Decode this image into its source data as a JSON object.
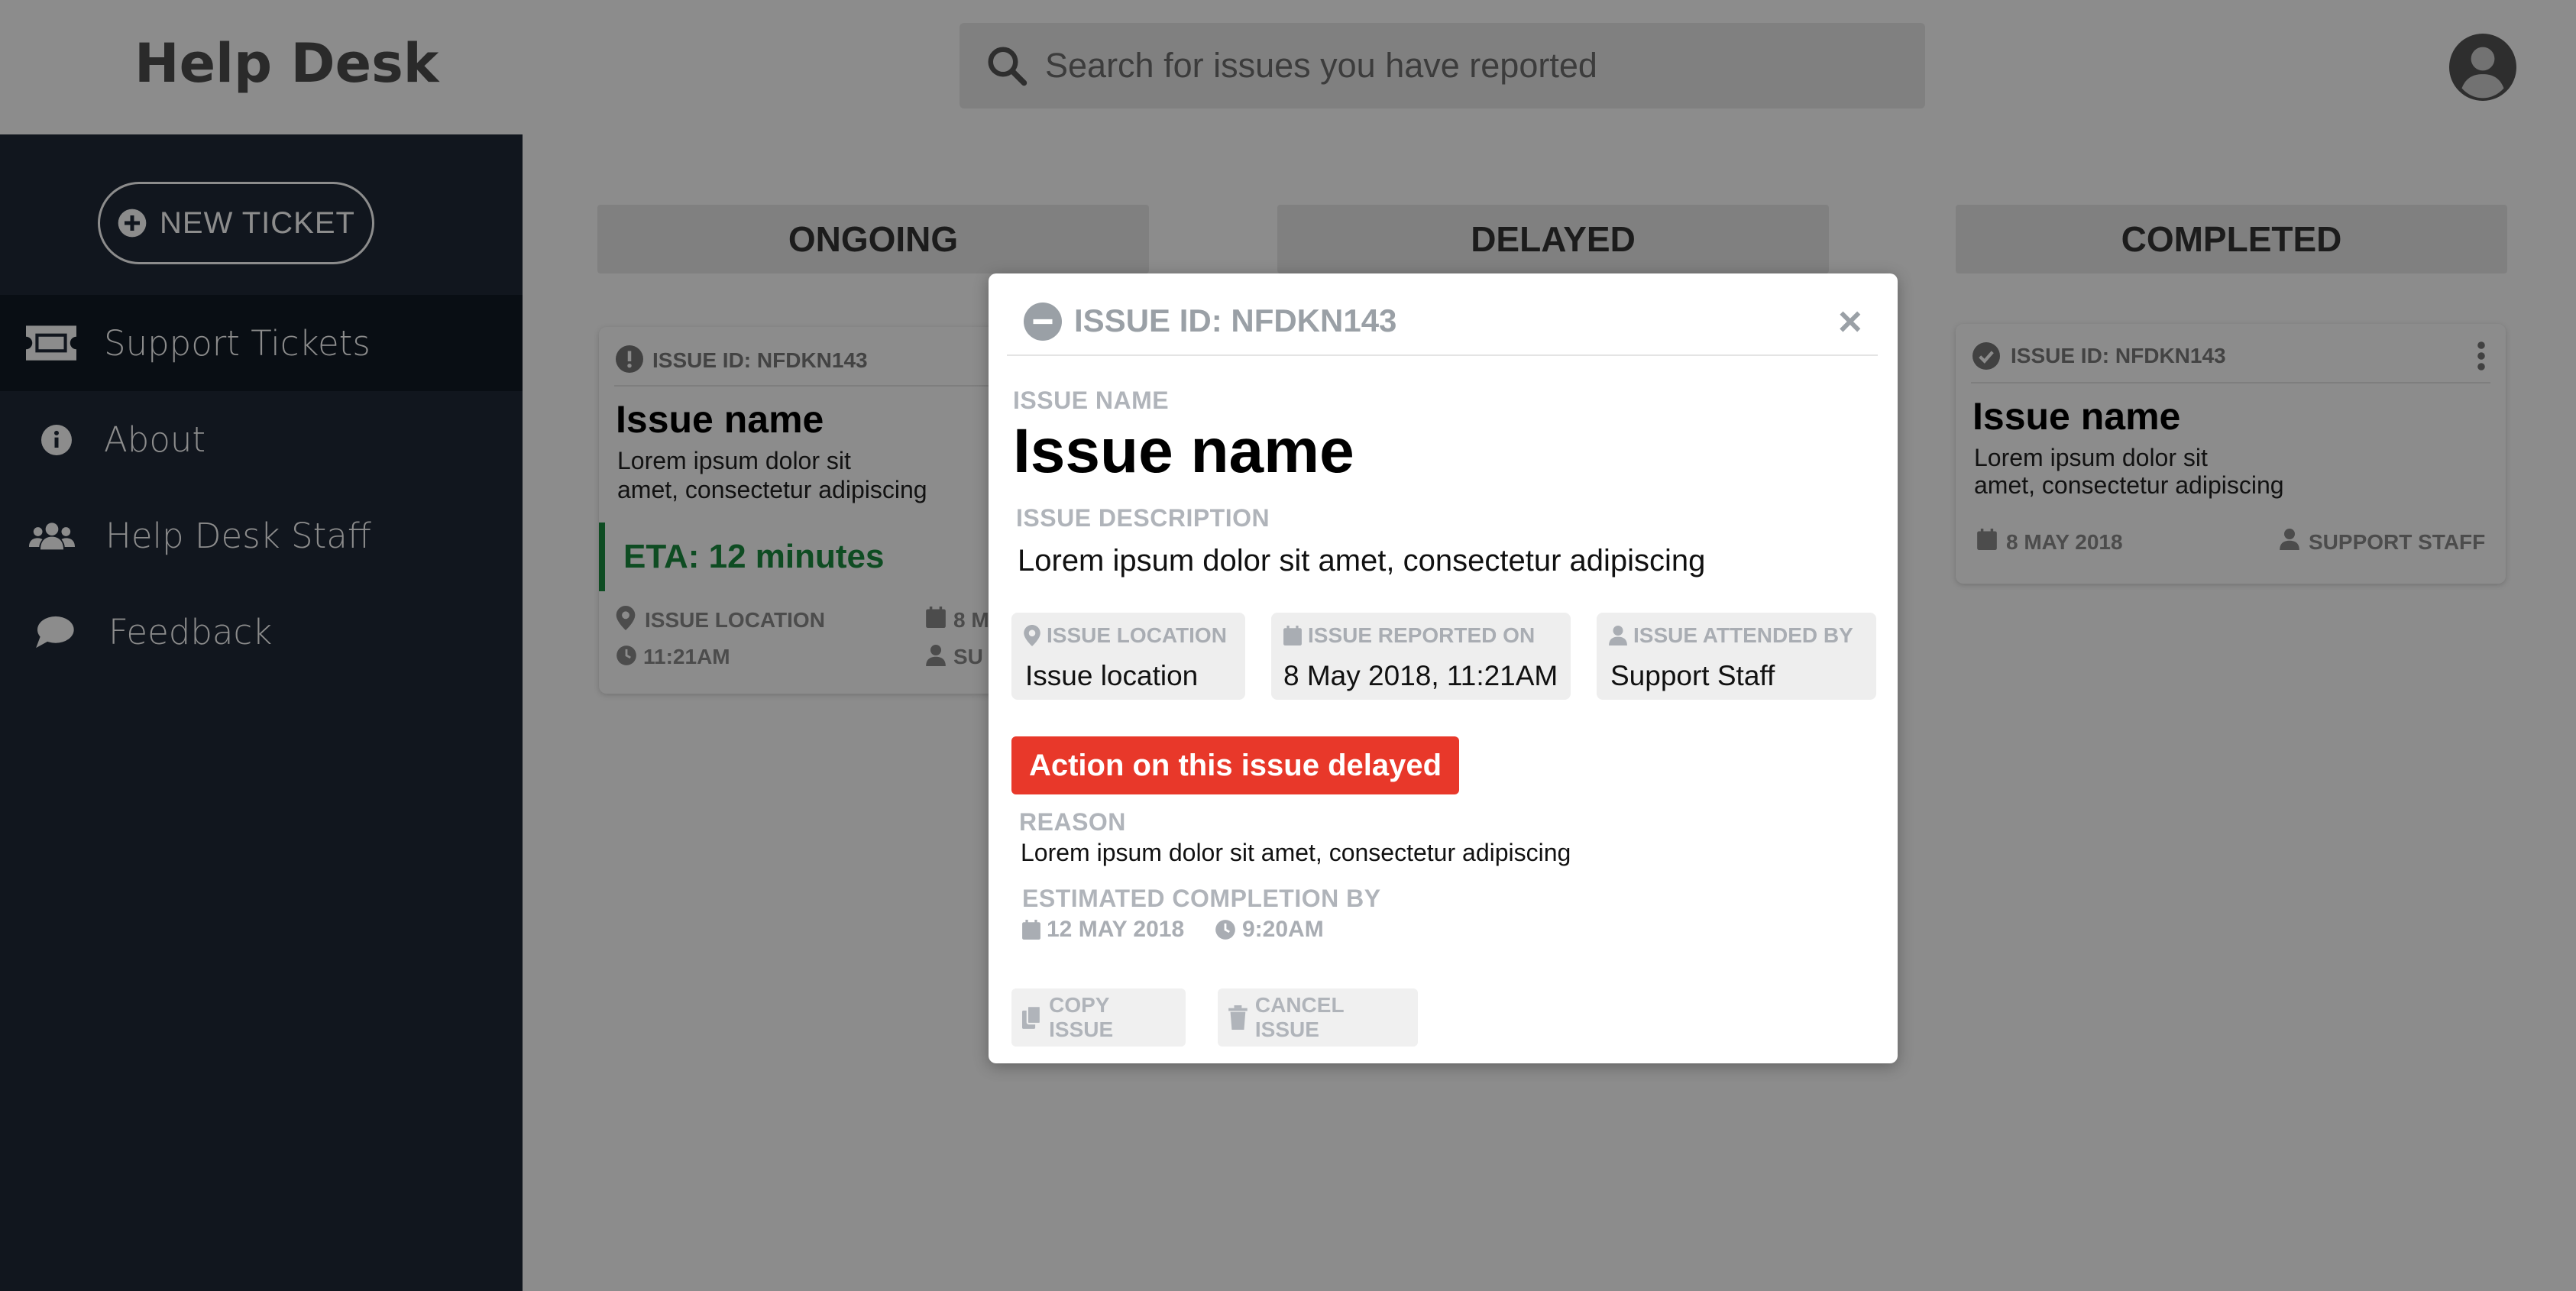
{
  "app": {
    "title": "Help Desk",
    "search_placeholder": "Search for issues you have reported"
  },
  "sidebar": {
    "new_ticket_label": "NEW TICKET",
    "items": [
      {
        "label": "Support Tickets",
        "icon": "ticket-icon",
        "active": true
      },
      {
        "label": "About",
        "icon": "info-icon",
        "active": false
      },
      {
        "label": "Help Desk Staff",
        "icon": "users-icon",
        "active": false
      },
      {
        "label": "Feedback",
        "icon": "chat-bubble-icon",
        "active": false
      }
    ]
  },
  "columns": [
    {
      "title": "ONGOING"
    },
    {
      "title": "DELAYED"
    },
    {
      "title": "COMPLETED"
    }
  ],
  "cards": {
    "ongoing": {
      "issue_id": "ISSUE ID: NFDKN143",
      "name": "Issue name",
      "desc_line1": "Lorem ipsum dolor sit",
      "desc_line2": "amet, consectetur adipiscing",
      "eta": "ETA: 12 minutes",
      "location_label": "ISSUE LOCATION",
      "time": "11:21AM",
      "date_partial": "8 M",
      "staff_partial": "SU"
    },
    "completed": {
      "issue_id": "ISSUE ID: NFDKN143",
      "name": "Issue name",
      "desc_line1": "Lorem ipsum dolor sit",
      "desc_line2": "amet, consectetur adipiscing",
      "date": "8 MAY 2018",
      "staff": "SUPPORT STAFF"
    }
  },
  "modal": {
    "issue_id": "ISSUE ID: NFDKN143",
    "close": "×",
    "issue_name_label": "ISSUE NAME",
    "issue_name": "Issue name",
    "description_label": "ISSUE DESCRIPTION",
    "description": "Lorem ipsum dolor sit amet, consectetur adipiscing",
    "location_label": "ISSUE LOCATION",
    "location": "Issue location",
    "reported_label": "ISSUE REPORTED ON",
    "reported": "8 May 2018, 11:21AM",
    "attended_label": "ISSUE ATTENDED BY",
    "attended": "Support Staff",
    "status_banner": "Action on this issue delayed",
    "reason_label": "REASON",
    "reason": "Lorem ipsum dolor sit amet, consectetur adipiscing",
    "estimated_label": "ESTIMATED COMPLETION BY",
    "est_date": "12 MAY 2018",
    "est_time": "9:20AM",
    "copy_label": "COPY ISSUE",
    "cancel_label": "CANCEL ISSUE"
  },
  "colors": {
    "sidebar_bg": "#1f2837",
    "sidebar_active": "#111a25",
    "eta_green": "#1a8a3f",
    "delay_red": "#e8382a",
    "overlay": "rgba(0,0,0,0.45)"
  }
}
